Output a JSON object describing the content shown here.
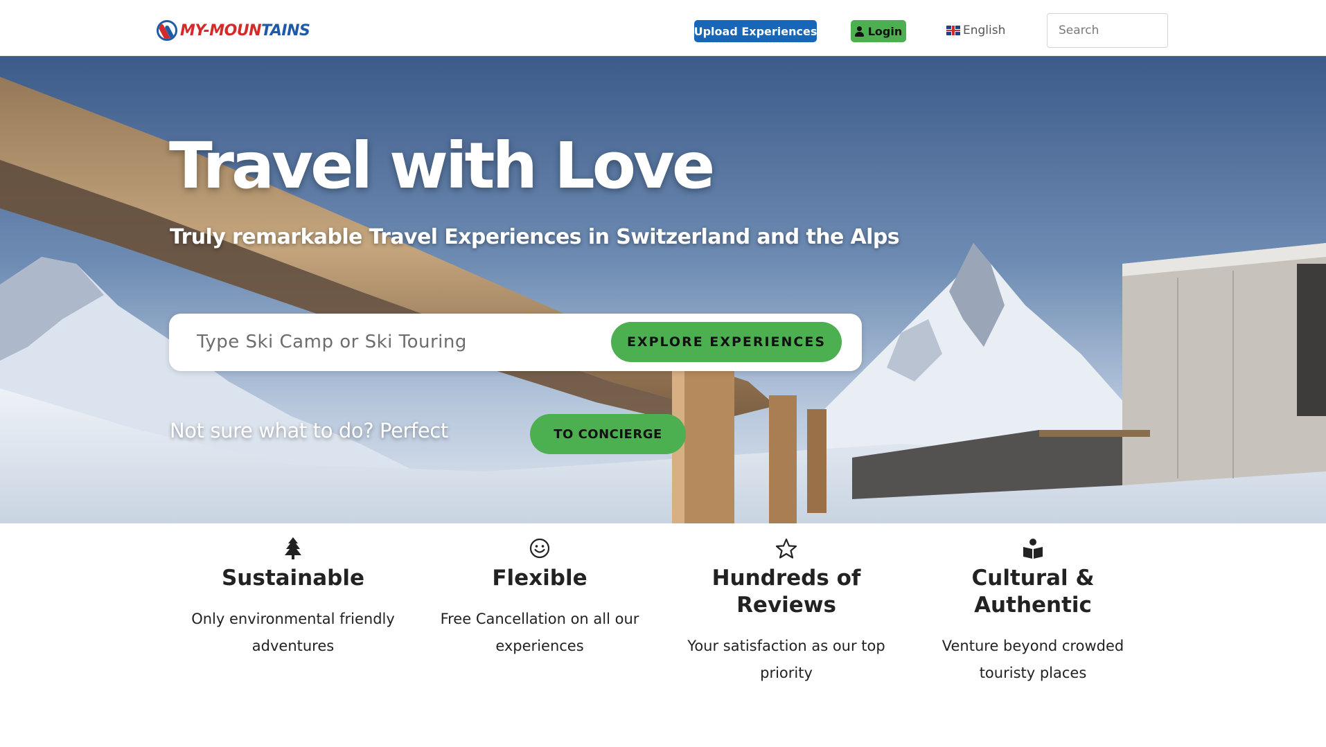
{
  "header": {
    "logo_text_red": "MY-MOUN",
    "logo_text_blue": "TAINS",
    "upload_label": "Upload Experiences",
    "login_label": "Login",
    "language_label": "English",
    "search_placeholder": "Search"
  },
  "hero": {
    "title": "Travel with Love",
    "subtitle": "Truly remarkable Travel Experiences in Switzerland and the Alps",
    "explore_placeholder": "Type Ski Camp or Ski Touring",
    "explore_button": "EXPLORE EXPERIENCES",
    "concierge_text": "Not sure what to do? Perfect",
    "concierge_button": "TO CONCIERGE"
  },
  "features": [
    {
      "icon": "tree-icon",
      "title": "Sustainable",
      "description": "Only environmental friendly adventures"
    },
    {
      "icon": "smiley-icon",
      "title": "Flexible",
      "description": "Free Cancellation on all our experiences"
    },
    {
      "icon": "star-icon",
      "title": "Hundreds of Reviews",
      "description": "Your satisfaction as our top priority"
    },
    {
      "icon": "book-reader-icon",
      "title": "Cultural & Authentic",
      "description": "Venture beyond crowded touristy places"
    }
  ],
  "colors": {
    "brand_red": "#d42a2a",
    "brand_blue": "#1f5aa6",
    "upload_button": "#1766b8",
    "accent_green": "#4caf50"
  }
}
